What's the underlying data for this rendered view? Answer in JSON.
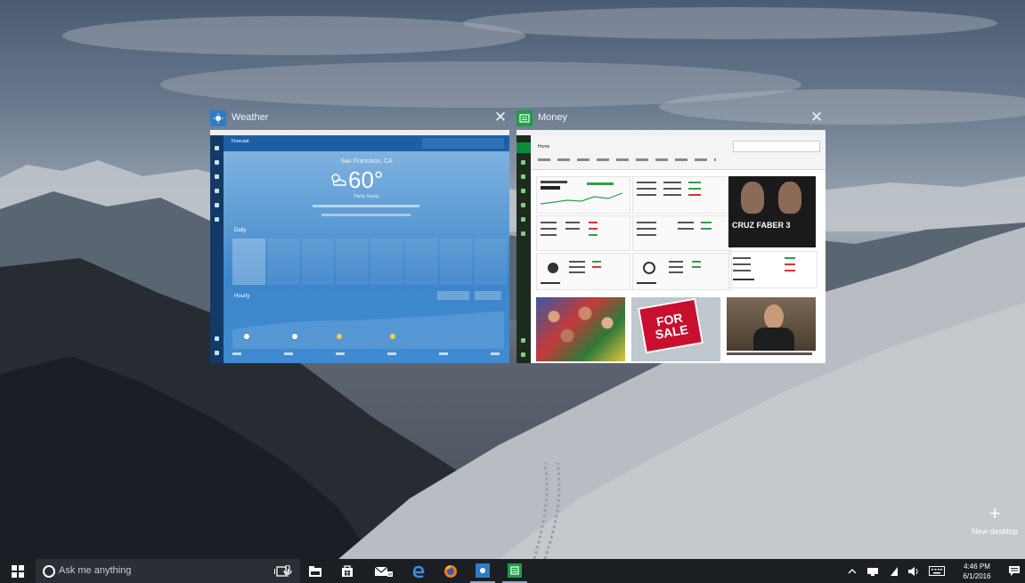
{
  "windows": [
    {
      "title": "Weather",
      "accent": "#2f7cc4",
      "icon": "weather-app-icon",
      "content": {
        "city": "San Francisco, CA",
        "temp": "60°",
        "condition": "Partly Sunny",
        "daily_label": "Daily",
        "hourly_label": "Hourly"
      }
    },
    {
      "title": "Money",
      "accent": "#1e9e47",
      "icon": "money-app-icon",
      "content": {
        "home_label": "Home",
        "promo": "CRUZ FABER 3",
        "sale_sign": "FOR SALE"
      }
    }
  ],
  "close_glyph": "✕",
  "new_desktop": {
    "plus": "+",
    "label": "New desktop"
  },
  "taskbar": {
    "search_placeholder": "Ask me anything",
    "pinned": [
      "task-view-icon",
      "store-icon",
      "file-explorer-icon",
      "store-bag-icon",
      "mail-icon",
      "edge-icon",
      "firefox-icon",
      "weather-app-icon",
      "money-app-icon"
    ],
    "tray": [
      "chevron-up-icon",
      "network-icon",
      "power-icon",
      "volume-icon",
      "keyboard-icon"
    ],
    "time": "4:46 PM",
    "date": "6/1/2016"
  },
  "colors": {
    "taskbar": "#1b1f24",
    "weather": "#2f7cc4",
    "money": "#1e9e47"
  }
}
